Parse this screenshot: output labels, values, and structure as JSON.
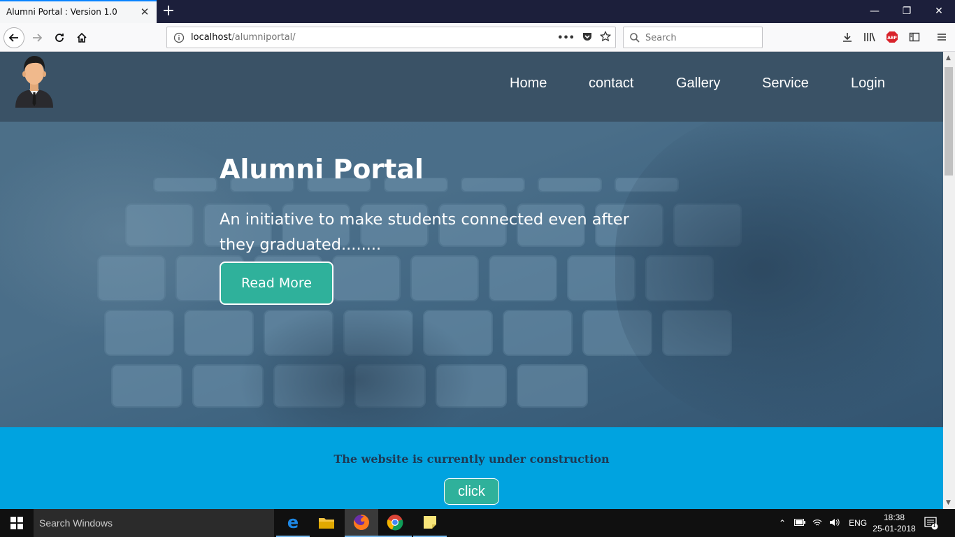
{
  "browser": {
    "tab_title": "Alumni Portal : Version 1.0",
    "url_host": "localhost",
    "url_path": "/alumniportal/",
    "search_placeholder": "Search",
    "page_actions_label": "•••"
  },
  "site": {
    "nav": [
      {
        "label": "Home"
      },
      {
        "label": "contact"
      },
      {
        "label": "Gallery"
      },
      {
        "label": "Service"
      },
      {
        "label": "Login"
      }
    ],
    "hero": {
      "title": "Alumni Portal",
      "subtitle": "An initiative to make students connected even after they graduated........",
      "button": "Read More"
    },
    "notice": {
      "text": "The website is currently under construction",
      "button": "click"
    }
  },
  "taskbar": {
    "search_text": "Search Windows",
    "language": "ENG",
    "time": "18:38",
    "date": "25-01-2018",
    "notification_count": "1"
  },
  "colors": {
    "accent": "#2fb19b",
    "notice_bg": "#00a3e0",
    "header_bg": "#3a5266"
  }
}
